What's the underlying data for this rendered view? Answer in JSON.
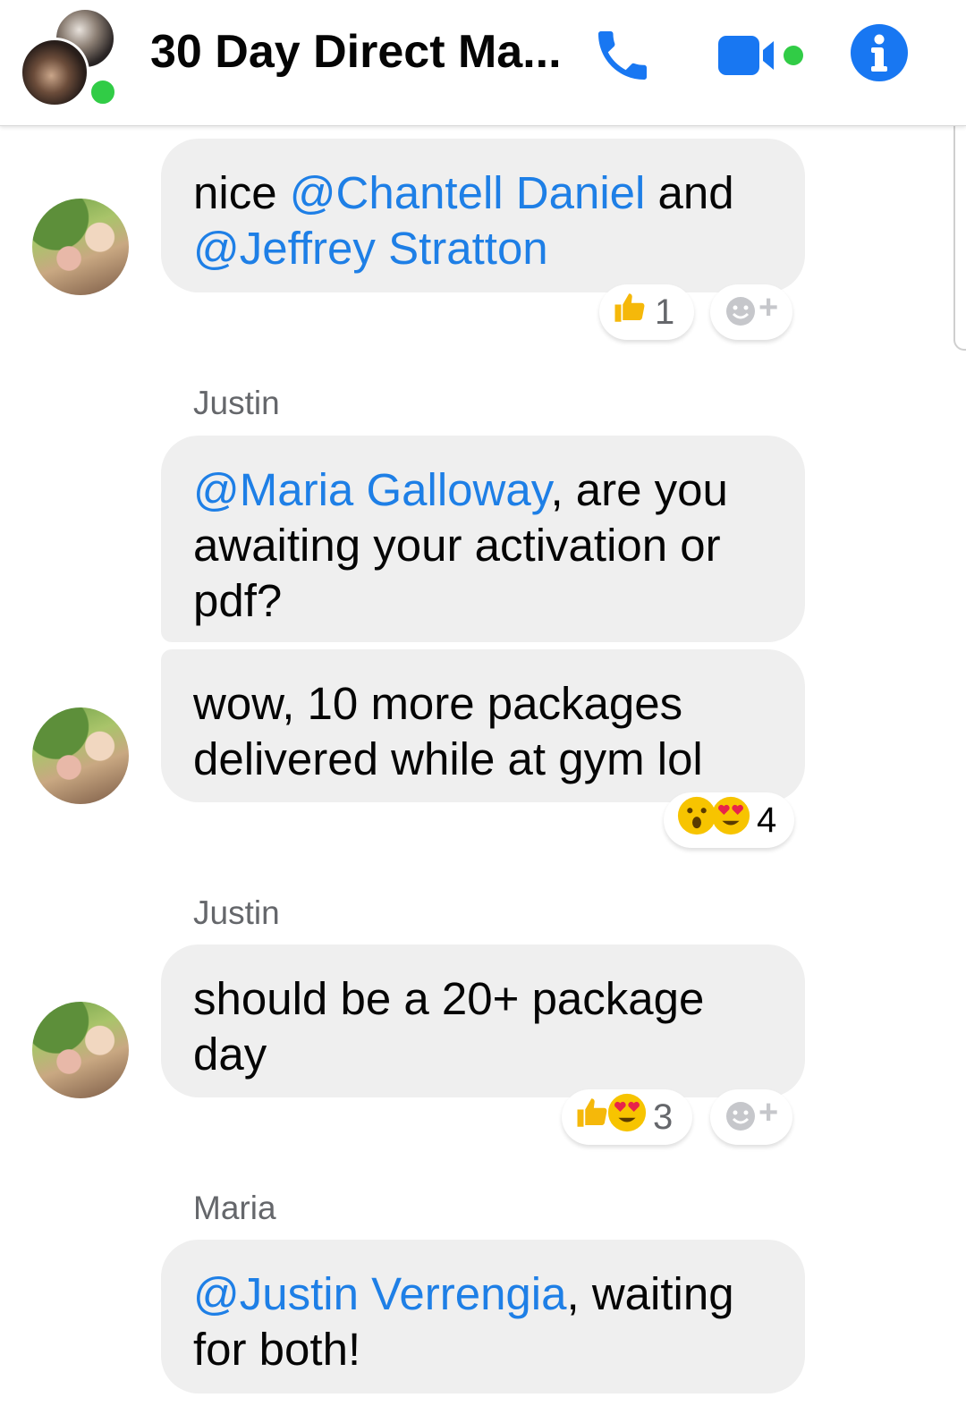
{
  "header": {
    "title": "30 Day Direct Ma...",
    "accent_color": "#1877f2",
    "online_color": "#31cc46",
    "icons": [
      "phone-icon",
      "video-call-icon",
      "info-icon"
    ]
  },
  "messages": [
    {
      "sender": "",
      "parts": [
        {
          "text": "nice ",
          "mention": false
        },
        {
          "text": "@Chantell Daniel",
          "mention": true
        },
        {
          "text": " and ",
          "mention": false
        },
        {
          "text": "@Jeffrey Stratton",
          "mention": true
        }
      ],
      "reaction": {
        "emojis": [
          "thumbs-up-emoji"
        ],
        "count": "1"
      },
      "add_reaction": "+"
    },
    {
      "sender": "Justin",
      "parts": [
        {
          "text": "@Maria Galloway",
          "mention": true
        },
        {
          "text": ", are you awaiting your activation or pdf?",
          "mention": false
        }
      ]
    },
    {
      "sender": "",
      "parts": [
        {
          "text": "wow, 10 more packages delivered while at gym lol",
          "mention": false
        }
      ],
      "reaction": {
        "emojis": [
          "surprised-face-emoji",
          "heart-eyes-emoji"
        ],
        "count": "4"
      }
    },
    {
      "sender": "Justin",
      "parts": [
        {
          "text": "should be a 20+ package day",
          "mention": false
        }
      ],
      "reaction": {
        "emojis": [
          "thumbs-up-emoji",
          "heart-eyes-emoji"
        ],
        "count": "3"
      },
      "add_reaction": "+"
    },
    {
      "sender": "Maria",
      "parts": [
        {
          "text": "@Justin Verrengia",
          "mention": true
        },
        {
          "text": ", waiting for both!",
          "mention": false
        }
      ]
    }
  ]
}
